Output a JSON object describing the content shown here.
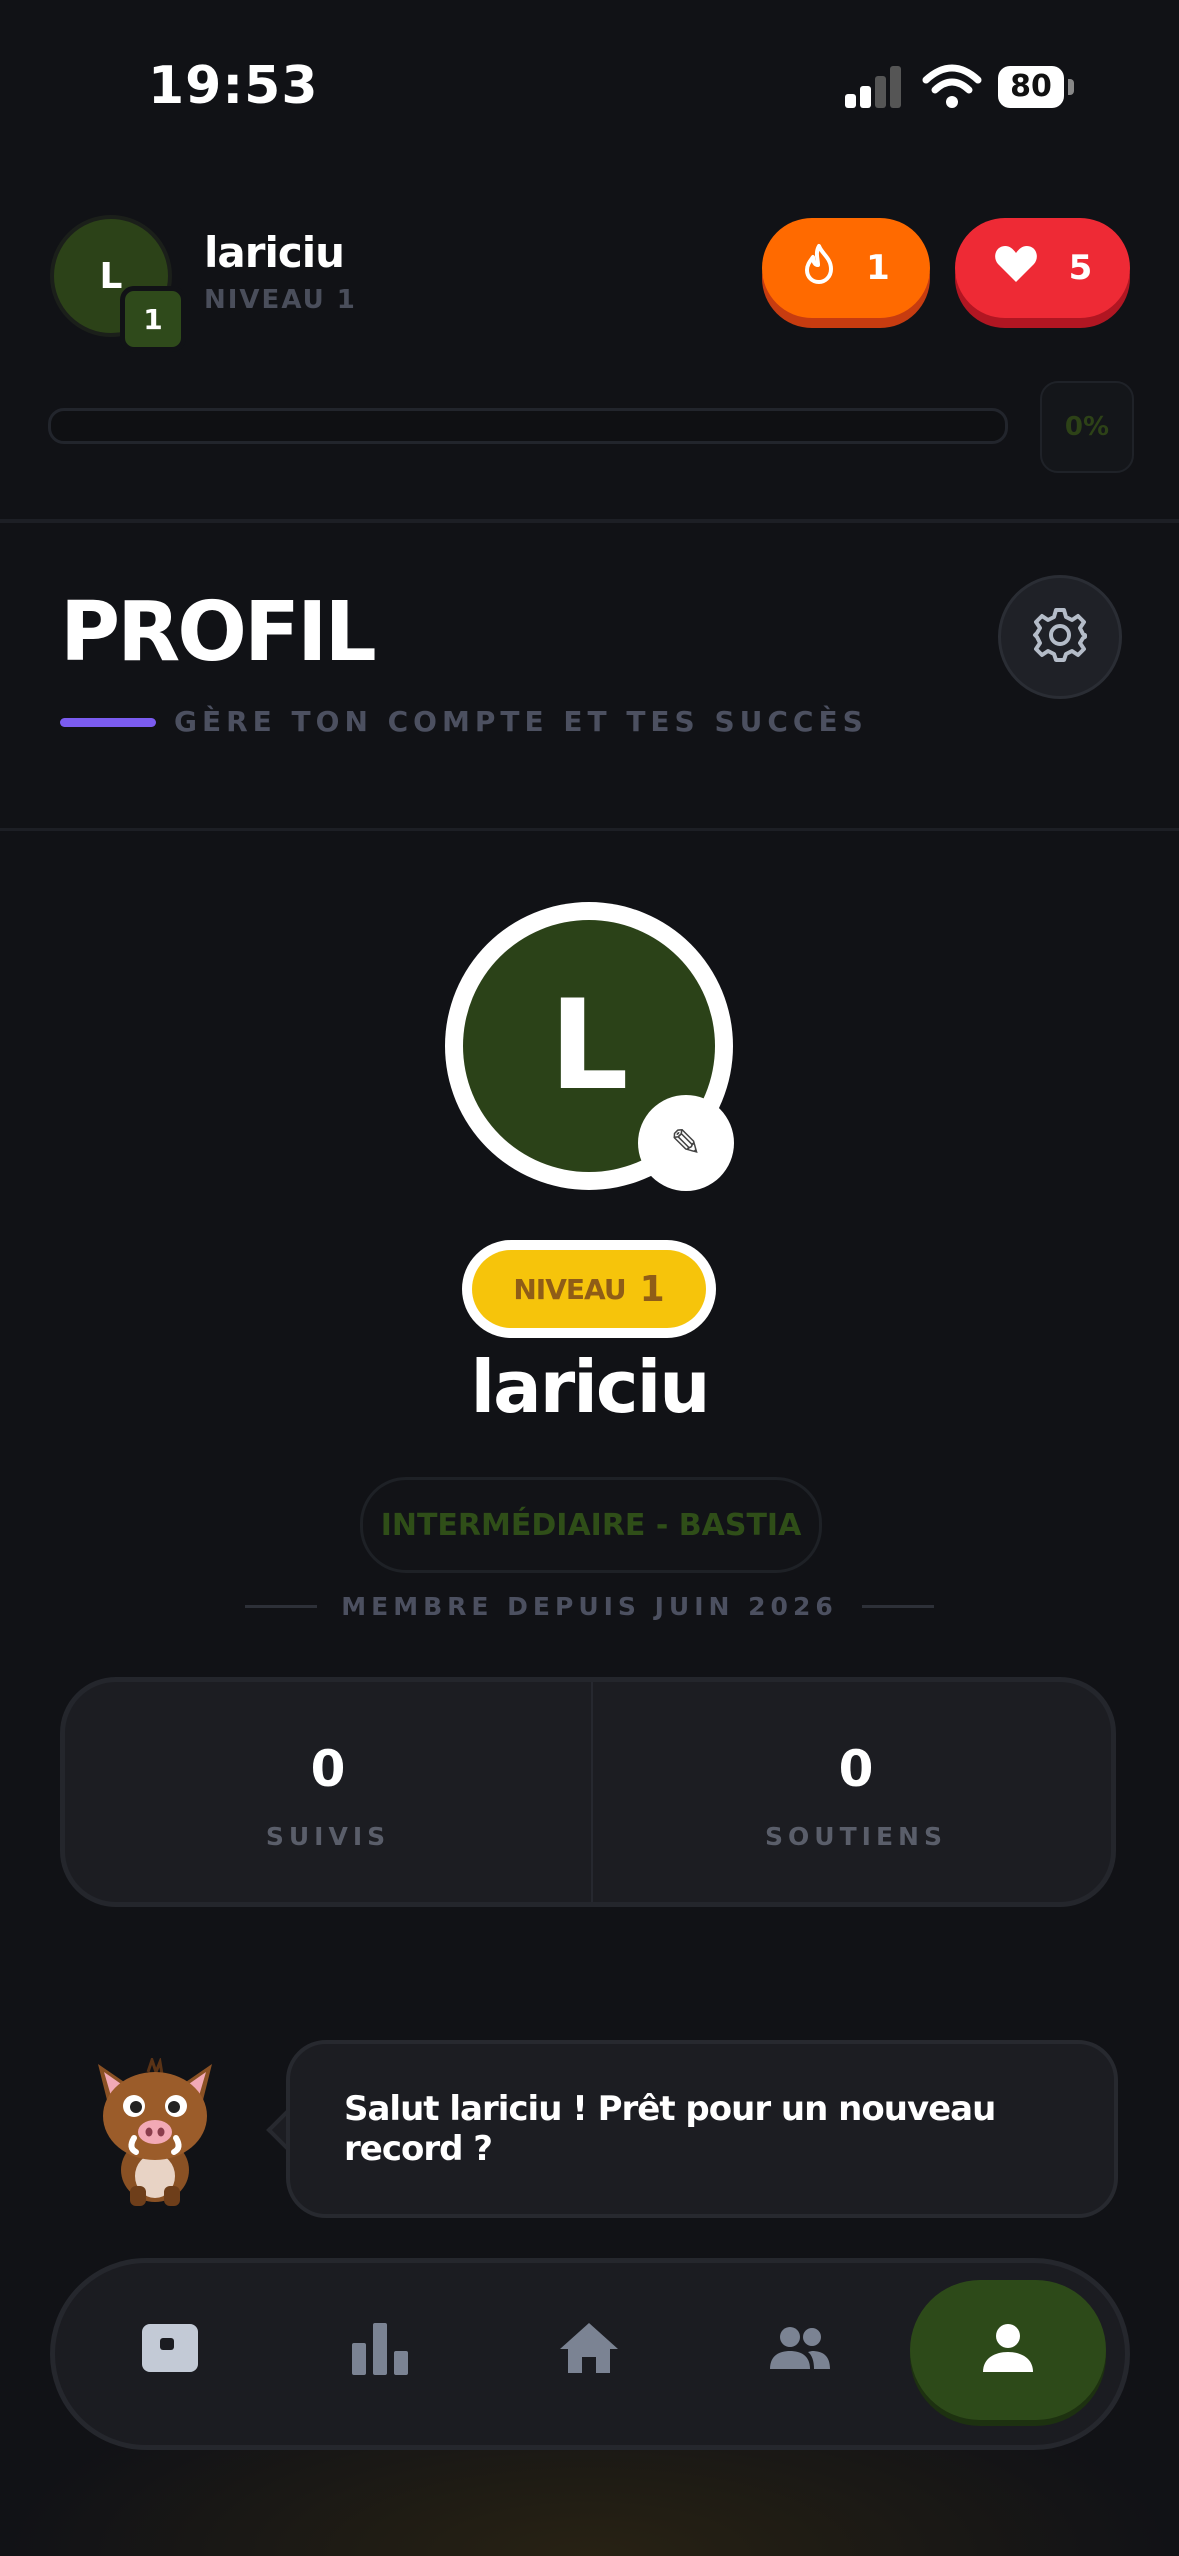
{
  "status_bar": {
    "time": "19:53",
    "battery": "80"
  },
  "header": {
    "avatar_letter": "L",
    "level_badge": "1",
    "username": "lariciu",
    "level_label": "NIVEAU 1",
    "streak_count": "1",
    "lives_count": "5",
    "progress_percent": "0%",
    "progress_fraction": 0
  },
  "page": {
    "title": "PROFIL",
    "subtitle": "GÈRE TON COMPTE ET TES SUCCÈS"
  },
  "profile": {
    "avatar_letter": "L",
    "edit_icon": "✎",
    "level_word": "NIVEAU",
    "level_number": "1",
    "name": "lariciu",
    "tag": "INTERMÉDIAIRE - BASTIA",
    "member_since": "MEMBRE DEPUIS JUIN 2026"
  },
  "stats": [
    {
      "value": "0",
      "label": "SUIVIS"
    },
    {
      "value": "0",
      "label": "SOUTIENS"
    }
  ],
  "mascot": {
    "message": "Salut lariciu ! Prêt pour un nouveau record ?"
  },
  "nav": {
    "items": [
      "cards-icon",
      "leaderboard-icon",
      "home-icon",
      "community-icon",
      "profile-icon"
    ],
    "active": "profile-icon"
  },
  "colors": {
    "background": "#111216",
    "accent_purple": "#7b5cf0",
    "streak_orange": "#ff6a00",
    "lives_red": "#ee2a35",
    "level_yellow": "#f6c40b",
    "avatar_green": "#2b4218"
  }
}
